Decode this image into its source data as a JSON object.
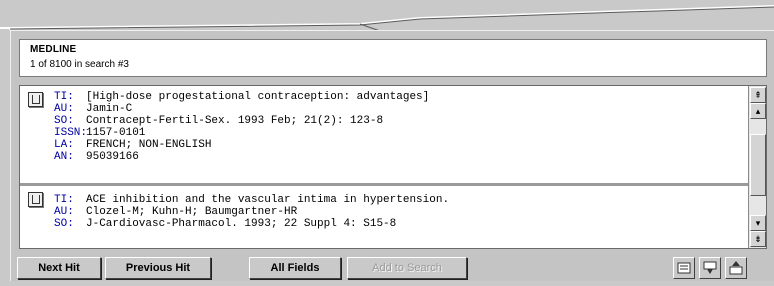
{
  "header": {
    "database": "MEDLINE",
    "position": "1 of 8100 in search #3"
  },
  "records": [
    {
      "fields": [
        {
          "tag": "TI:",
          "value": "[High-dose progestational contraception: advantages]"
        },
        {
          "tag": "AU:",
          "value": "Jamin-C"
        },
        {
          "tag": "SO:",
          "value": "Contracept-Fertil-Sex. 1993 Feb; 21(2): 123-8"
        },
        {
          "tag": "ISSN:",
          "value": "1157-0101"
        },
        {
          "tag": "LA:",
          "value": "FRENCH; NON-ENGLISH"
        },
        {
          "tag": "AN:",
          "value": "95039166"
        }
      ]
    },
    {
      "fields": [
        {
          "tag": "TI:",
          "value": "ACE inhibition and the vascular intima in hypertension."
        },
        {
          "tag": "AU:",
          "value": "Clozel-M; Kuhn-H; Baumgartner-HR"
        },
        {
          "tag": "SO:",
          "value": "J-Cardiovasc-Pharmacol. 1993; 22 Suppl 4: S15-8"
        }
      ]
    }
  ],
  "buttons": {
    "next_hit": "Next Hit",
    "previous_hit": "Previous Hit",
    "all_fields": "All Fields",
    "add_to_search": "Add to Search"
  },
  "icons": {
    "record": "book-icon",
    "scroll_up": "scroll-up-icon",
    "scroll_down": "scroll-down-icon",
    "print": "print-icon",
    "filter": "filter-icon",
    "export": "export-icon"
  },
  "colors": {
    "tag": "#0000a0",
    "panel": "#c4c4c4"
  }
}
